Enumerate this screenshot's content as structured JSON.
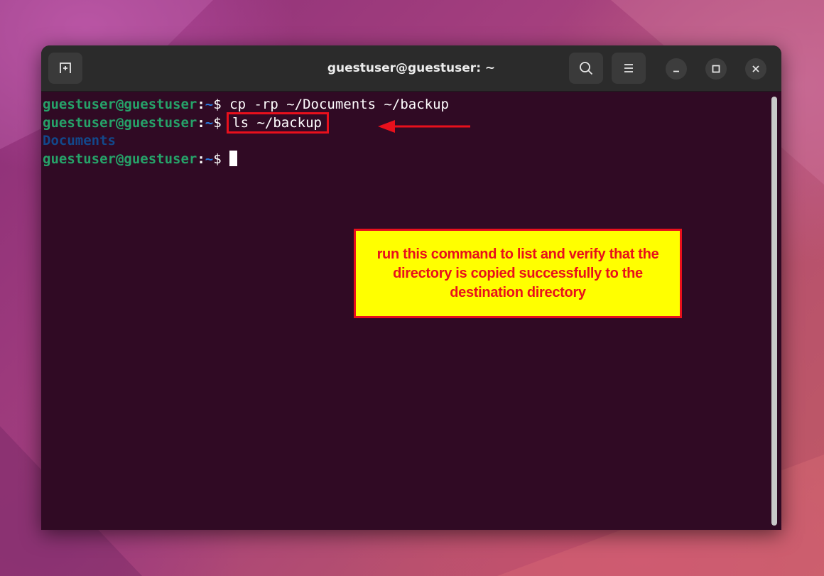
{
  "window": {
    "title": "guestuser@guestuser: ~"
  },
  "headerbar": {
    "new_tab_icon": "new-tab-icon",
    "search_icon": "search-icon",
    "menu_icon": "hamburger-menu-icon",
    "minimize_icon": "minimize-icon",
    "maximize_icon": "maximize-icon",
    "close_icon": "close-icon"
  },
  "terminal": {
    "lines": [
      {
        "user_host": "guestuser@guestuser",
        "colon": ":",
        "path": "~",
        "sign": "$ ",
        "command": "cp -rp ~/Documents ~/backup"
      },
      {
        "user_host": "guestuser@guestuser",
        "colon": ":",
        "path": "~",
        "sign": "$ ",
        "command": "ls ~/backup"
      },
      {
        "output": "Documents"
      },
      {
        "user_host": "guestuser@guestuser",
        "colon": ":",
        "path": "~",
        "sign": "$ ",
        "command": ""
      }
    ]
  },
  "annotation": {
    "text": "run this command to list and verify that the directory is copied successfully to the destination directory"
  },
  "colors": {
    "terminal_bg": "#300a24",
    "prompt_user": "#26a269",
    "prompt_path": "#2a7bde",
    "directory_output": "#12488b",
    "annotation_red": "#e8101c",
    "annotation_yellow": "#ffff00"
  }
}
